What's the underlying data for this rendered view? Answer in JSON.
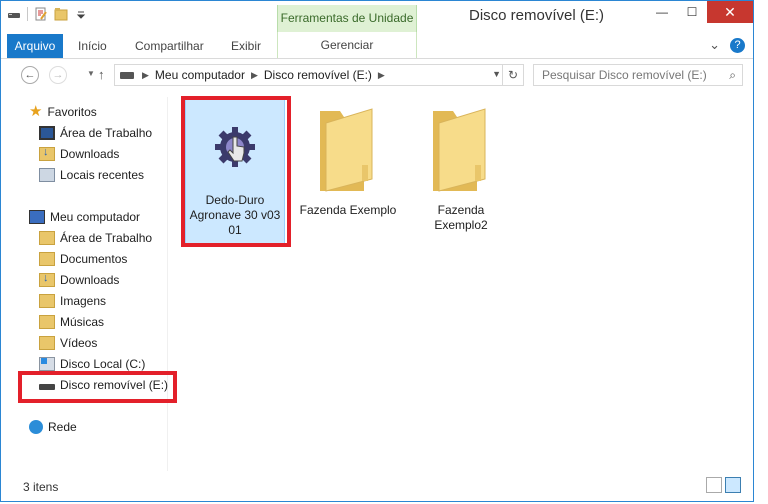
{
  "title_bar": {
    "context_tab_group": "Ferramentas de Unidade",
    "window_title": "Disco removível (E:)",
    "minimize": "—",
    "maximize": "☐",
    "close": "✕"
  },
  "ribbon": {
    "file_tab": "Arquivo",
    "tabs": [
      "Início",
      "Compartilhar",
      "Exibir"
    ],
    "context_tab": "Gerenciar",
    "collapse": "⌄",
    "help": "?"
  },
  "address_bar": {
    "back": "←",
    "forward": "→",
    "up": "↑",
    "crumbs": [
      "Meu computador",
      "Disco removível (E:)"
    ],
    "refresh": "↻",
    "search_placeholder": "Pesquisar Disco removível (E:)",
    "search_icon": "⌕"
  },
  "sidebar": {
    "favorites": "Favoritos",
    "fav_items": [
      "Área de Trabalho",
      "Downloads",
      "Locais recentes"
    ],
    "computer": "Meu computador",
    "computer_items": [
      "Área de Trabalho",
      "Documentos",
      "Downloads",
      "Imagens",
      "Músicas",
      "Vídeos",
      "Disco Local (C:)",
      "Disco removível (E:)"
    ],
    "network": "Rede"
  },
  "content": {
    "items": [
      {
        "label_line1": "Dedo-Duro",
        "label_line2": "Agronave 30 v03",
        "label_line3": "01",
        "type": "application",
        "selected": true
      },
      {
        "label_line1": "Fazenda Exemplo",
        "type": "folder"
      },
      {
        "label_line1": "Fazenda",
        "label_line2": "Exemplo2",
        "type": "folder"
      }
    ]
  },
  "status_bar": {
    "count": "3 itens"
  },
  "colors": {
    "accent": "#1979ca",
    "context_tab": "#dff1d4",
    "highlight": "#e3202a",
    "selection": "#cce8ff"
  }
}
